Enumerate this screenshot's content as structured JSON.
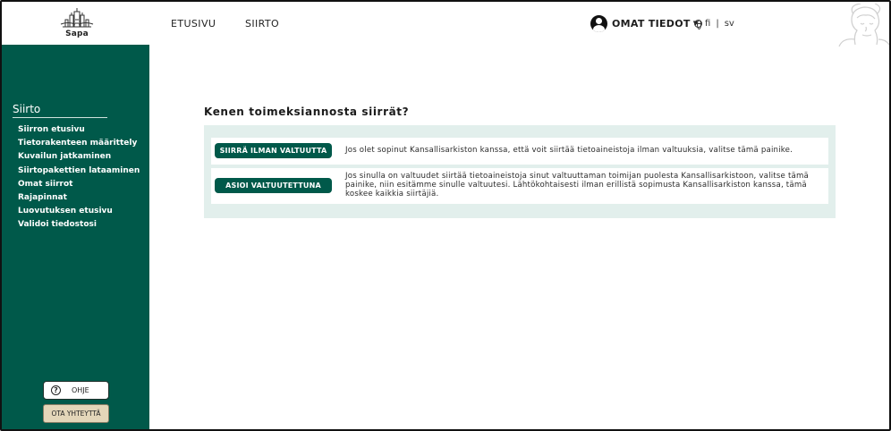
{
  "header": {
    "logo_text": "Sapa",
    "nav": [
      {
        "label": "ETUSIVU"
      },
      {
        "label": "SIIRTO"
      }
    ],
    "user_menu_label": "OMAT TIEDOT",
    "lang_active": "fi",
    "lang_other": "sv",
    "lang_separator": "|"
  },
  "sidebar": {
    "title": "Siirto",
    "items": [
      {
        "label": "Siirron etusivu"
      },
      {
        "label": "Tietorakenteen määrittely"
      },
      {
        "label": "Kuvailun jatkaminen"
      },
      {
        "label": "Siirtopakettien lataaminen"
      },
      {
        "label": "Omat siirrot"
      },
      {
        "label": "Rajapinnat"
      },
      {
        "label": "Luovutuksen etusivu"
      },
      {
        "label": "Validoi tiedostosi"
      }
    ],
    "help_label": "OHJE",
    "contact_label": "OTA YHTEYTTÄ"
  },
  "main": {
    "heading": "Kenen toimeksiannosta siirrät?",
    "options": [
      {
        "button_label": "SIIRRÄ ILMAN VALTUUTTA",
        "description": "Jos olet sopinut Kansallisarkiston kanssa, että voit siirtää tietoaineistoja ilman valtuuksia, valitse tämä painike."
      },
      {
        "button_label": "ASIOI VALTUUTETTUNA",
        "description": "Jos sinulla on valtuudet siirtää tietoaineistoja sinut valtuuttaman toimijan puolesta Kansallisarkistoon, valitse tämä painike, niin esitämme sinulle valtuutesi. Lähtökohtaisesti ilman erillistä sopimusta Kansallisarkiston kanssa, tämä koskee kaikkia siirtäjiä."
      }
    ]
  },
  "colors": {
    "sidebar_green": "#00594a",
    "panel_bg": "#e2efec",
    "contact_button_bg": "#e3d6b9"
  }
}
